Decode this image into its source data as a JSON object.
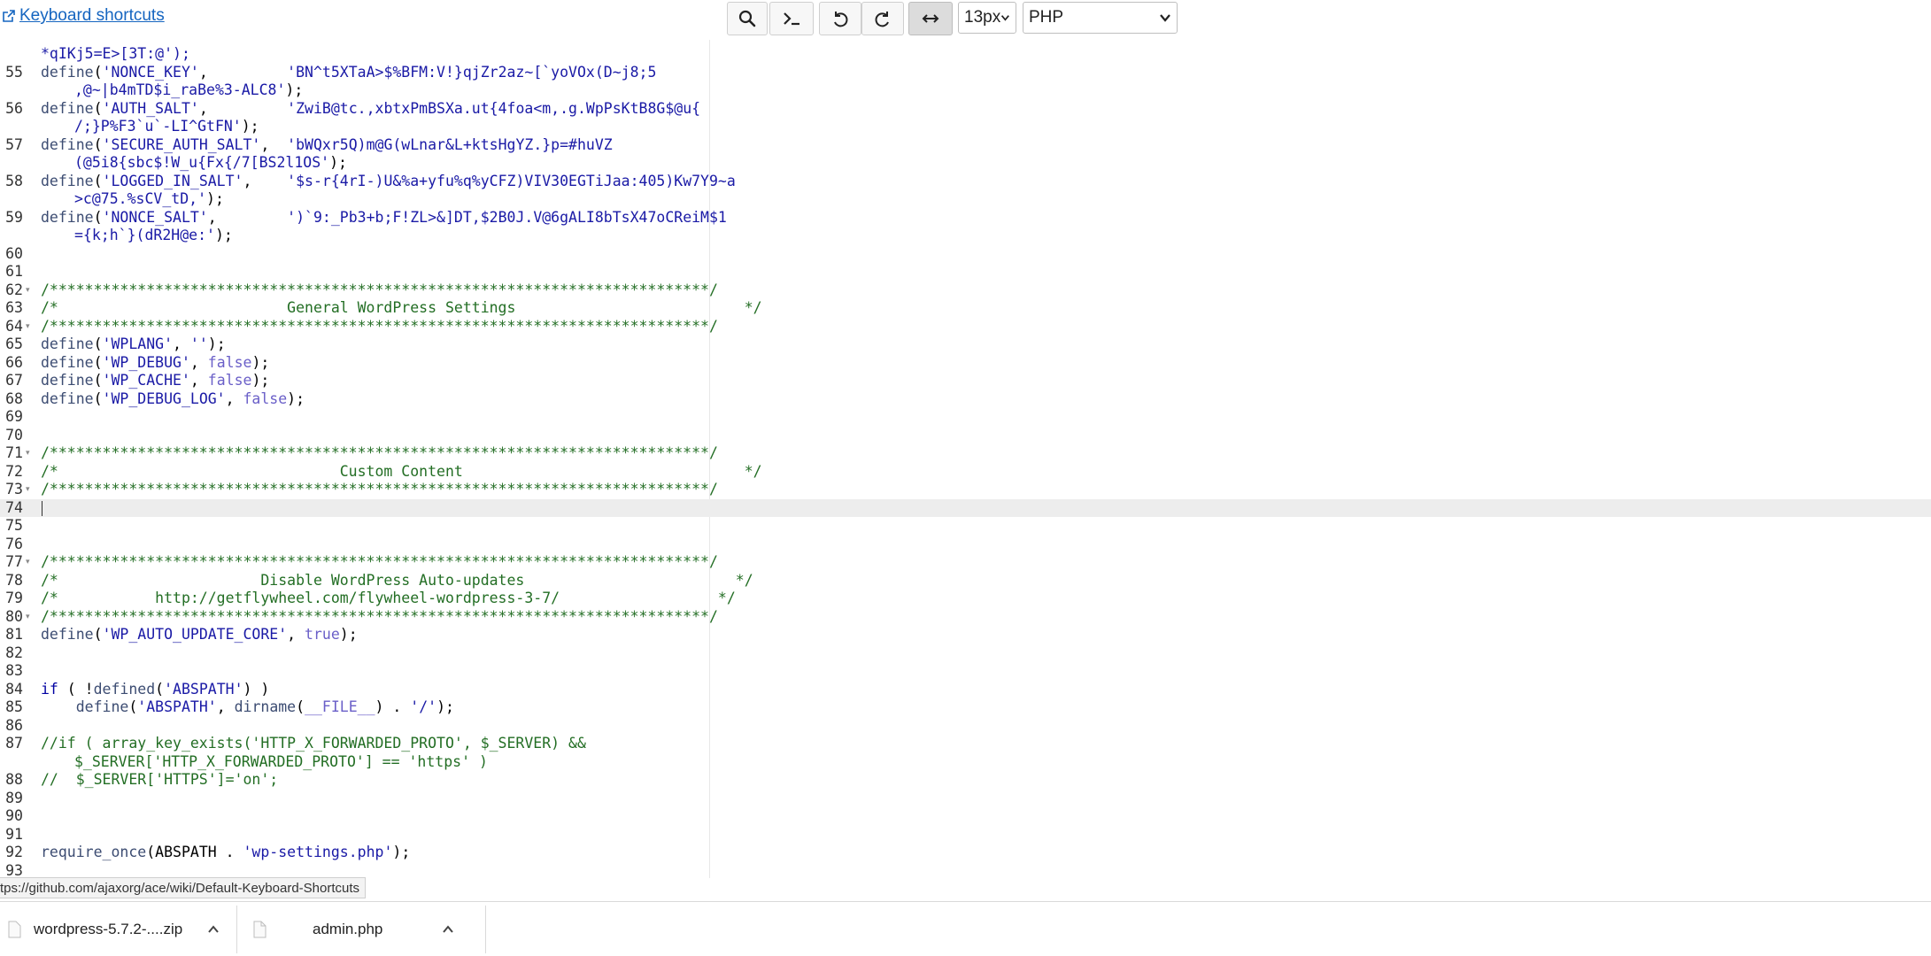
{
  "toolbar": {
    "keyboard_shortcuts": "Keyboard shortcuts",
    "font_size": "13px",
    "mode": "PHP"
  },
  "editor": {
    "lines": [
      {
        "num": "",
        "fold": false,
        "segs": [
          [
            [
              "t-s",
              "*qIKj5=E>[3T:@');"
            ]
          ]
        ]
      },
      {
        "num": "55",
        "fold": false,
        "segs": [
          [
            [
              "t-f",
              "define"
            ],
            [
              "t-p",
              "("
            ],
            [
              "t-s",
              "'NONCE_KEY'"
            ],
            [
              "t-p",
              ",         "
            ],
            [
              "t-s",
              "'BN^t5XTaA>$%BFM:V!}qjZr2az~[`yoVOx(D~j8;5"
            ]
          ],
          [
            [
              "t-s",
              ",@~|b4mTD$i_raBe%3-ALC8'"
            ],
            [
              "t-p",
              ");"
            ]
          ]
        ]
      },
      {
        "num": "56",
        "fold": false,
        "segs": [
          [
            [
              "t-f",
              "define"
            ],
            [
              "t-p",
              "("
            ],
            [
              "t-s",
              "'AUTH_SALT'"
            ],
            [
              "t-p",
              ",         "
            ],
            [
              "t-s",
              "'ZwiB@tc.,xbtxPmBSXa.ut{4foa<m,.g.WpPsKtB8G$@u{"
            ]
          ],
          [
            [
              "t-s",
              "/;}P%F3`u`-LI^GtFN'"
            ],
            [
              "t-p",
              ");"
            ]
          ]
        ]
      },
      {
        "num": "57",
        "fold": false,
        "segs": [
          [
            [
              "t-f",
              "define"
            ],
            [
              "t-p",
              "("
            ],
            [
              "t-s",
              "'SECURE_AUTH_SALT'"
            ],
            [
              "t-p",
              ",  "
            ],
            [
              "t-s",
              "'bWQxr5Q)m@G(wLnar&L+ktsHgYZ.}p=#huVZ"
            ]
          ],
          [
            [
              "t-s",
              "(@5i8{sbc$!W_u{Fx{/7[BS2l1OS'"
            ],
            [
              "t-p",
              ");"
            ]
          ]
        ]
      },
      {
        "num": "58",
        "fold": false,
        "segs": [
          [
            [
              "t-f",
              "define"
            ],
            [
              "t-p",
              "("
            ],
            [
              "t-s",
              "'LOGGED_IN_SALT'"
            ],
            [
              "t-p",
              ",    "
            ],
            [
              "t-s",
              "'$s-r{4rI-)U&%a+yfu%q%yCFZ)VIV30EGTiJaa:405)Kw7Y9~a"
            ]
          ],
          [
            [
              "t-s",
              ">c@75.%sCV_tD,'"
            ],
            [
              "t-p",
              ");"
            ]
          ]
        ]
      },
      {
        "num": "59",
        "fold": false,
        "segs": [
          [
            [
              "t-f",
              "define"
            ],
            [
              "t-p",
              "("
            ],
            [
              "t-s",
              "'NONCE_SALT'"
            ],
            [
              "t-p",
              ",        "
            ],
            [
              "t-s",
              "')`9:_Pb3+b;F!ZL>&]DT,$2B0J.V@6gALI8bTsX47oCReiM$1"
            ]
          ],
          [
            [
              "t-s",
              "={k;h`}(dR2H@e:'"
            ],
            [
              "t-p",
              ");"
            ]
          ]
        ]
      },
      {
        "num": "60",
        "fold": false,
        "segs": [
          []
        ]
      },
      {
        "num": "61",
        "fold": false,
        "segs": [
          []
        ]
      },
      {
        "num": "62",
        "fold": true,
        "segs": [
          [
            [
              "t-c",
              "/***************************************************************************/"
            ]
          ]
        ]
      },
      {
        "num": "63",
        "fold": false,
        "segs": [
          [
            [
              "t-c",
              "/*                          General WordPress Settings                          */"
            ]
          ]
        ]
      },
      {
        "num": "64",
        "fold": true,
        "segs": [
          [
            [
              "t-c",
              "/***************************************************************************/"
            ]
          ]
        ]
      },
      {
        "num": "65",
        "fold": false,
        "segs": [
          [
            [
              "t-f",
              "define"
            ],
            [
              "t-p",
              "("
            ],
            [
              "t-s",
              "'WPLANG'"
            ],
            [
              "t-p",
              ", "
            ],
            [
              "t-s",
              "''"
            ],
            [
              "t-p",
              ");"
            ]
          ]
        ]
      },
      {
        "num": "66",
        "fold": false,
        "segs": [
          [
            [
              "t-f",
              "define"
            ],
            [
              "t-p",
              "("
            ],
            [
              "t-s",
              "'WP_DEBUG'"
            ],
            [
              "t-p",
              ", "
            ],
            [
              "t-b",
              "false"
            ],
            [
              "t-p",
              ");"
            ]
          ]
        ]
      },
      {
        "num": "67",
        "fold": false,
        "segs": [
          [
            [
              "t-f",
              "define"
            ],
            [
              "t-p",
              "("
            ],
            [
              "t-s",
              "'WP_CACHE'"
            ],
            [
              "t-p",
              ", "
            ],
            [
              "t-b",
              "false"
            ],
            [
              "t-p",
              ");"
            ]
          ]
        ]
      },
      {
        "num": "68",
        "fold": false,
        "segs": [
          [
            [
              "t-f",
              "define"
            ],
            [
              "t-p",
              "("
            ],
            [
              "t-s",
              "'WP_DEBUG_LOG'"
            ],
            [
              "t-p",
              ", "
            ],
            [
              "t-b",
              "false"
            ],
            [
              "t-p",
              ");"
            ]
          ]
        ]
      },
      {
        "num": "69",
        "fold": false,
        "segs": [
          []
        ]
      },
      {
        "num": "70",
        "fold": false,
        "segs": [
          []
        ]
      },
      {
        "num": "71",
        "fold": true,
        "segs": [
          [
            [
              "t-c",
              "/***************************************************************************/"
            ]
          ]
        ]
      },
      {
        "num": "72",
        "fold": false,
        "segs": [
          [
            [
              "t-c",
              "/*                                Custom Content                                */"
            ]
          ]
        ]
      },
      {
        "num": "73",
        "fold": true,
        "segs": [
          [
            [
              "t-c",
              "/***************************************************************************/"
            ]
          ]
        ]
      },
      {
        "num": "74",
        "fold": false,
        "active": true,
        "segs": [
          []
        ]
      },
      {
        "num": "75",
        "fold": false,
        "segs": [
          []
        ]
      },
      {
        "num": "76",
        "fold": false,
        "segs": [
          []
        ]
      },
      {
        "num": "77",
        "fold": true,
        "segs": [
          [
            [
              "t-c",
              "/***************************************************************************/"
            ]
          ]
        ]
      },
      {
        "num": "78",
        "fold": false,
        "segs": [
          [
            [
              "t-c",
              "/*                       Disable WordPress Auto-updates                        */"
            ]
          ]
        ]
      },
      {
        "num": "79",
        "fold": false,
        "segs": [
          [
            [
              "t-c",
              "/*           http://getflywheel.com/flywheel-wordpress-3-7/                  */"
            ]
          ]
        ]
      },
      {
        "num": "80",
        "fold": true,
        "segs": [
          [
            [
              "t-c",
              "/***************************************************************************/"
            ]
          ]
        ]
      },
      {
        "num": "81",
        "fold": false,
        "segs": [
          [
            [
              "t-f",
              "define"
            ],
            [
              "t-p",
              "("
            ],
            [
              "t-s",
              "'WP_AUTO_UPDATE_CORE'"
            ],
            [
              "t-p",
              ", "
            ],
            [
              "t-b",
              "true"
            ],
            [
              "t-p",
              ");"
            ]
          ]
        ]
      },
      {
        "num": "82",
        "fold": false,
        "segs": [
          []
        ]
      },
      {
        "num": "83",
        "fold": false,
        "segs": [
          []
        ]
      },
      {
        "num": "84",
        "fold": false,
        "segs": [
          [
            [
              "t-k",
              "if"
            ],
            [
              "t-p",
              " ( !"
            ],
            [
              "t-f",
              "defined"
            ],
            [
              "t-p",
              "("
            ],
            [
              "t-s",
              "'ABSPATH'"
            ],
            [
              "t-p",
              ") )"
            ]
          ]
        ]
      },
      {
        "num": "85",
        "fold": false,
        "segs": [
          [
            [
              "t-p",
              "    "
            ],
            [
              "t-f",
              "define"
            ],
            [
              "t-p",
              "("
            ],
            [
              "t-s",
              "'ABSPATH'"
            ],
            [
              "t-p",
              ", "
            ],
            [
              "t-f",
              "dirname"
            ],
            [
              "t-p",
              "("
            ],
            [
              "t-b",
              "__FILE__"
            ],
            [
              "t-p",
              ") . "
            ],
            [
              "t-s",
              "'/'"
            ],
            [
              "t-p",
              ");"
            ]
          ]
        ]
      },
      {
        "num": "86",
        "fold": false,
        "segs": [
          []
        ]
      },
      {
        "num": "87",
        "fold": false,
        "segs": [
          [
            [
              "t-c",
              "//if ( array_key_exists('HTTP_X_FORWARDED_PROTO', $_SERVER) &&"
            ]
          ],
          [
            [
              "t-c",
              "$_SERVER['HTTP_X_FORWARDED_PROTO'] == 'https' )"
            ]
          ]
        ]
      },
      {
        "num": "88",
        "fold": false,
        "segs": [
          [
            [
              "t-c",
              "//  $_SERVER['HTTPS']='on';"
            ]
          ]
        ]
      },
      {
        "num": "89",
        "fold": false,
        "segs": [
          []
        ]
      },
      {
        "num": "90",
        "fold": false,
        "segs": [
          []
        ]
      },
      {
        "num": "91",
        "fold": false,
        "segs": [
          []
        ]
      },
      {
        "num": "92",
        "fold": false,
        "segs": [
          [
            [
              "t-f",
              "require_once"
            ],
            [
              "t-p",
              "(ABSPATH . "
            ],
            [
              "t-s",
              "'wp-settings.php'"
            ],
            [
              "t-p",
              ");"
            ]
          ]
        ]
      },
      {
        "num": "93",
        "fold": false,
        "segs": [
          []
        ]
      }
    ]
  },
  "status": {
    "url": "tps://github.com/ajaxorg/ace/wiki/Default-Keyboard-Shortcuts"
  },
  "downloads": {
    "items": [
      {
        "name": "wordpress-5.7.2-....zip"
      },
      {
        "name": "admin.php"
      }
    ]
  },
  "icons": {
    "external": "external-link-icon",
    "search": "search-icon",
    "terminal": "terminal-icon",
    "undo": "undo-icon",
    "redo": "redo-icon",
    "wrap": "horizontal-arrows-icon"
  }
}
